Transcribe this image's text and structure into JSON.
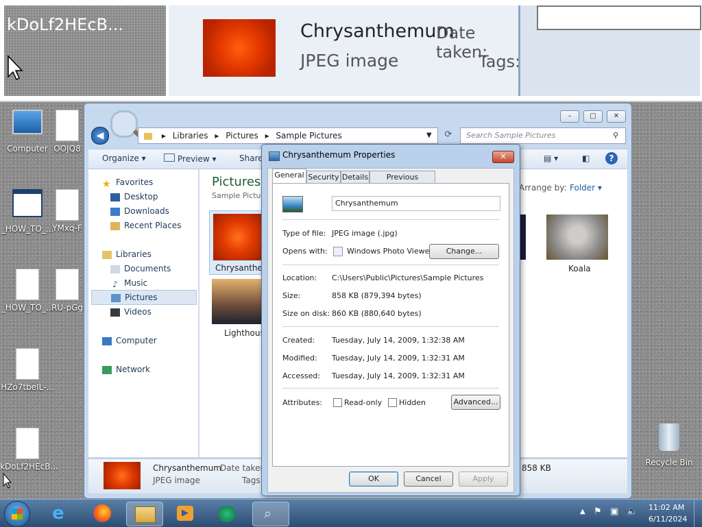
{
  "magnifier": {
    "left_text": "kDoLf2HEcB...",
    "file_name": "Chrysanthemum",
    "file_type": "JPEG image",
    "date_label": "Date taken:",
    "tags_label": "Tags:"
  },
  "desktop": {
    "icons": [
      {
        "label": "Computer"
      },
      {
        "label": "OOJQ8"
      },
      {
        "label": "_HOW_TO_..."
      },
      {
        "label": "YMxq-F"
      },
      {
        "label": "_HOW_TO_..."
      },
      {
        "label": "RU-pGg"
      },
      {
        "label": "HZo7tbeIL-..."
      },
      {
        "label": "kDoLf2HEcB..."
      },
      {
        "label": "Recycle Bin"
      }
    ]
  },
  "explorer": {
    "breadcrumb": [
      "Libraries",
      "Pictures",
      "Sample Pictures"
    ],
    "search_placeholder": "Search Sample Pictures",
    "toolbar": {
      "organize": "Organize",
      "preview": "Preview",
      "share": "Share"
    },
    "nav": {
      "favorites": "Favorites",
      "desktop": "Desktop",
      "downloads": "Downloads",
      "recent": "Recent Places",
      "libraries": "Libraries",
      "documents": "Documents",
      "music": "Music",
      "pictures": "Pictures",
      "videos": "Videos",
      "computer": "Computer",
      "network": "Network"
    },
    "content": {
      "title": "Pictures",
      "subtitle": "Sample Pictur",
      "arrange_label": "Arrange by:",
      "arrange_value": "Folder",
      "items": [
        "Chrysanthem",
        "Lighthous",
        "Koala"
      ]
    },
    "details": {
      "name": "Chrysanthemum",
      "date_label": "Date taken:",
      "type": "JPEG image",
      "tags_label": "Tags:",
      "size": "858 KB"
    }
  },
  "dialog": {
    "title": "Chrysanthemum Properties",
    "tabs": [
      "General",
      "Security",
      "Details",
      "Previous Versions"
    ],
    "filename": "Chrysanthemum",
    "type_label": "Type of file:",
    "type_value": "JPEG image (.jpg)",
    "opens_label": "Opens with:",
    "opens_value": "Windows Photo Viewer",
    "change_button": "Change...",
    "location_label": "Location:",
    "location_value": "C:\\Users\\Public\\Pictures\\Sample Pictures",
    "size_label": "Size:",
    "size_value": "858 KB (879,394 bytes)",
    "disk_label": "Size on disk:",
    "disk_value": "860 KB (880,640 bytes)",
    "created_label": "Created:",
    "created_value": "Tuesday, July 14, 2009, 1:32:38 AM",
    "modified_label": "Modified:",
    "modified_value": "Tuesday, July 14, 2009, 1:32:31 AM",
    "accessed_label": "Accessed:",
    "accessed_value": "Tuesday, July 14, 2009, 1:32:31 AM",
    "attributes_label": "Attributes:",
    "readonly_label": "Read-only",
    "hidden_label": "Hidden",
    "advanced_button": "Advanced...",
    "ok": "OK",
    "cancel": "Cancel",
    "apply": "Apply"
  },
  "taskbar": {
    "time": "11:02 AM",
    "date": "6/11/2024"
  }
}
